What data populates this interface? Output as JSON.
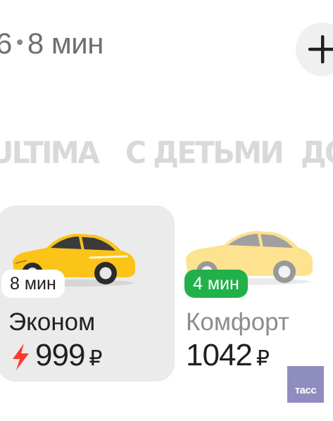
{
  "route": {
    "left_fragment": "6",
    "separator": "•",
    "duration": "8 мин"
  },
  "add_button": {
    "icon": "plus-icon"
  },
  "categories": [
    {
      "label": "ULTIMA"
    },
    {
      "label": "С ДЕТЬМИ"
    },
    {
      "label": "ДО"
    }
  ],
  "tariffs": [
    {
      "eta": "8 мин",
      "name": "Эконом",
      "price": "999",
      "currency": "₽",
      "surge_icon": "lightning-icon",
      "surge_color": "#ff3b30",
      "car_color": "#fcc419",
      "badge_color": "#ffffff",
      "selected": true
    },
    {
      "eta": "4 мин",
      "name": "Комфорт",
      "price": "1042",
      "currency": "₽",
      "car_color": "#fcc419",
      "badge_color": "#22b04b",
      "selected": false
    }
  ],
  "watermark": {
    "text": "тасс",
    "color": "#8f8cc0"
  }
}
